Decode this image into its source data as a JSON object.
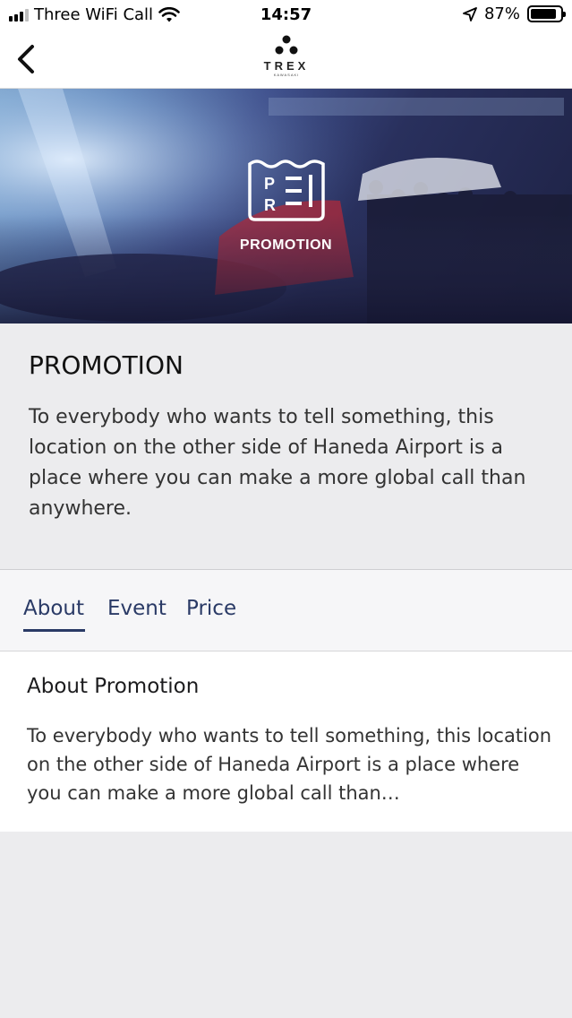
{
  "status_bar": {
    "carrier": "Three WiFi Call",
    "time": "14:57",
    "battery": "87%"
  },
  "nav": {
    "logo_text": "TREX",
    "logo_subtext": "KAWASAKI"
  },
  "hero": {
    "badge_letters": [
      "P",
      "R"
    ],
    "label": "PROMOTION"
  },
  "info": {
    "title": "PROMOTION",
    "description": "To everybody who wants to tell something, this location on the other side of Haneda Airport is a place where you can make a more global call than anywhere."
  },
  "tabs": [
    {
      "label": "About",
      "active": true
    },
    {
      "label": "Event",
      "active": false
    },
    {
      "label": "Price",
      "active": false
    }
  ],
  "about": {
    "title": "About Promotion",
    "text": "To everybody who wants to tell something, this location on the other side of Haneda Airport is a place where you can make a more global call than…"
  },
  "colors": {
    "tab_accent": "#2a3a66",
    "page_background": "#ececee"
  }
}
